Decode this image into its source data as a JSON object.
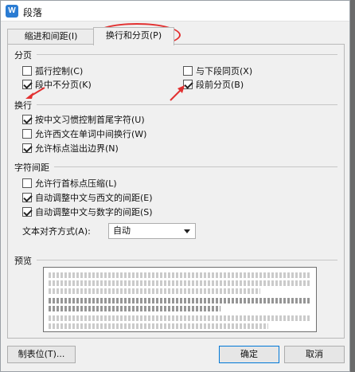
{
  "window": {
    "title": "段落",
    "app_icon": "W"
  },
  "tabs": [
    {
      "label": "缩进和间距(I)"
    },
    {
      "label": "换行和分页(P)"
    }
  ],
  "sections": {
    "pagination": {
      "title": "分页",
      "options": [
        {
          "label": "孤行控制(C)",
          "checked": false
        },
        {
          "label": "与下段同页(X)",
          "checked": false
        },
        {
          "label": "段中不分页(K)",
          "checked": true
        },
        {
          "label": "段前分页(B)",
          "checked": true
        }
      ]
    },
    "line_break": {
      "title": "换行",
      "options": [
        {
          "label": "按中文习惯控制首尾字符(U)",
          "checked": true
        },
        {
          "label": "允许西文在单词中间换行(W)",
          "checked": false
        },
        {
          "label": "允许标点溢出边界(N)",
          "checked": true
        }
      ]
    },
    "char_spacing": {
      "title": "字符间距",
      "options": [
        {
          "label": "允许行首标点压缩(L)",
          "checked": false
        },
        {
          "label": "自动调整中文与西文的间距(E)",
          "checked": true
        },
        {
          "label": "自动调整中文与数字的间距(S)",
          "checked": true
        }
      ],
      "alignment_label": "文本对齐方式(A):",
      "alignment_value": "自动"
    },
    "preview": {
      "title": "预览"
    }
  },
  "buttons": {
    "tabs": "制表位(T)...",
    "ok": "确定",
    "cancel": "取消"
  },
  "colors": {
    "annotation": "#e23131",
    "accent": "#2b7cd3"
  }
}
